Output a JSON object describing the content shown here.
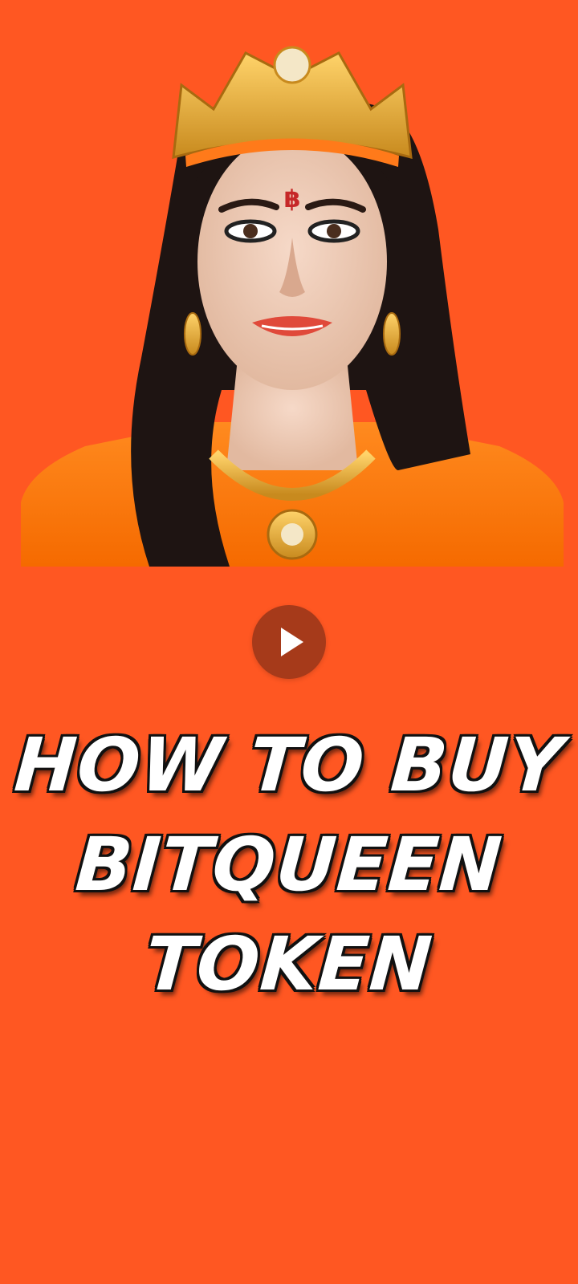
{
  "hero": {
    "icon": "portrait-image",
    "forehead_symbol": "฿"
  },
  "play": {
    "icon": "play-icon"
  },
  "headline": {
    "line1": "HOW TO BUY",
    "line2": "BITQUEEN",
    "line3": "TOKEN"
  },
  "colors": {
    "background": "#FF5722",
    "play_button": "#A63A1A",
    "headline_text": "#FFFFFF",
    "headline_outline": "#111111"
  }
}
